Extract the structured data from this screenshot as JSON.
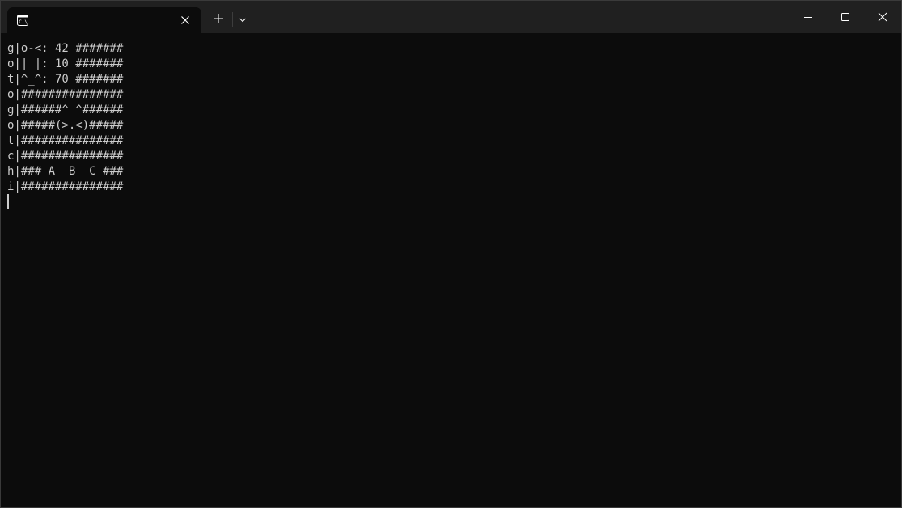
{
  "tab": {
    "title": "",
    "icon": "terminal-icon",
    "close_icon": "close-icon"
  },
  "toolbar": {
    "new_tab_icon": "plus-icon",
    "dropdown_icon": "chevron-down-icon"
  },
  "window_controls": {
    "minimize_icon": "minimize-icon",
    "maximize_icon": "maximize-icon",
    "close_icon": "close-icon"
  },
  "terminal": {
    "lines": [
      "g|o-<: 42 #######",
      "o||_|: 10 #######",
      "t|^_^: 70 #######",
      "o|###############",
      "g|######^ ^######",
      "o|#####(>.<)#####",
      "t|###############",
      "c|###############",
      "h|### A  B  C ###",
      "i|###############"
    ]
  },
  "colors": {
    "background": "#0c0c0c",
    "titlebar": "#202020",
    "text": "#cccccc"
  }
}
